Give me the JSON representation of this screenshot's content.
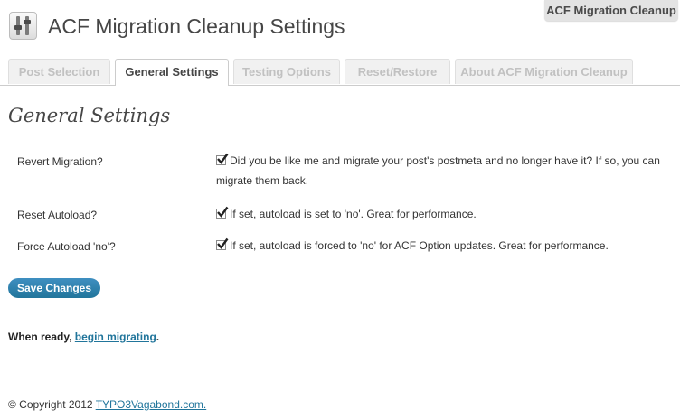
{
  "screen_tab": {
    "label": "ACF Migration Cleanup"
  },
  "header": {
    "title": "ACF Migration Cleanup Settings",
    "icon": "settings-sliders-icon"
  },
  "tabs": [
    {
      "label": "Post Selection",
      "active": false
    },
    {
      "label": "General Settings",
      "active": true
    },
    {
      "label": "Testing Options",
      "active": false
    },
    {
      "label": "Reset/Restore",
      "active": false
    },
    {
      "label": "About ACF Migration Cleanup",
      "active": false
    }
  ],
  "section": {
    "title": "General Settings"
  },
  "settings": [
    {
      "label": "Revert Migration?",
      "checked": true,
      "description": "Did you be like me and migrate your post's postmeta and no longer have it? If so, you can migrate them back."
    },
    {
      "label": "Reset Autoload?",
      "checked": true,
      "description": "If set, autoload is set to 'no'. Great for performance."
    },
    {
      "label": "Force Autoload 'no'?",
      "checked": true,
      "description": "If set, autoload is forced to 'no' for ACF Option updates. Great for performance."
    }
  ],
  "save_button": {
    "label": "Save Changes"
  },
  "ready": {
    "prefix": "When ready, ",
    "link": "begin migrating",
    "suffix": "."
  },
  "footer": {
    "prefix": "© Copyright 2012 ",
    "link": "TYPO3Vagabond.com."
  },
  "colors": {
    "accent": "#21759b",
    "tab_inactive_text": "#c1c1c1"
  }
}
